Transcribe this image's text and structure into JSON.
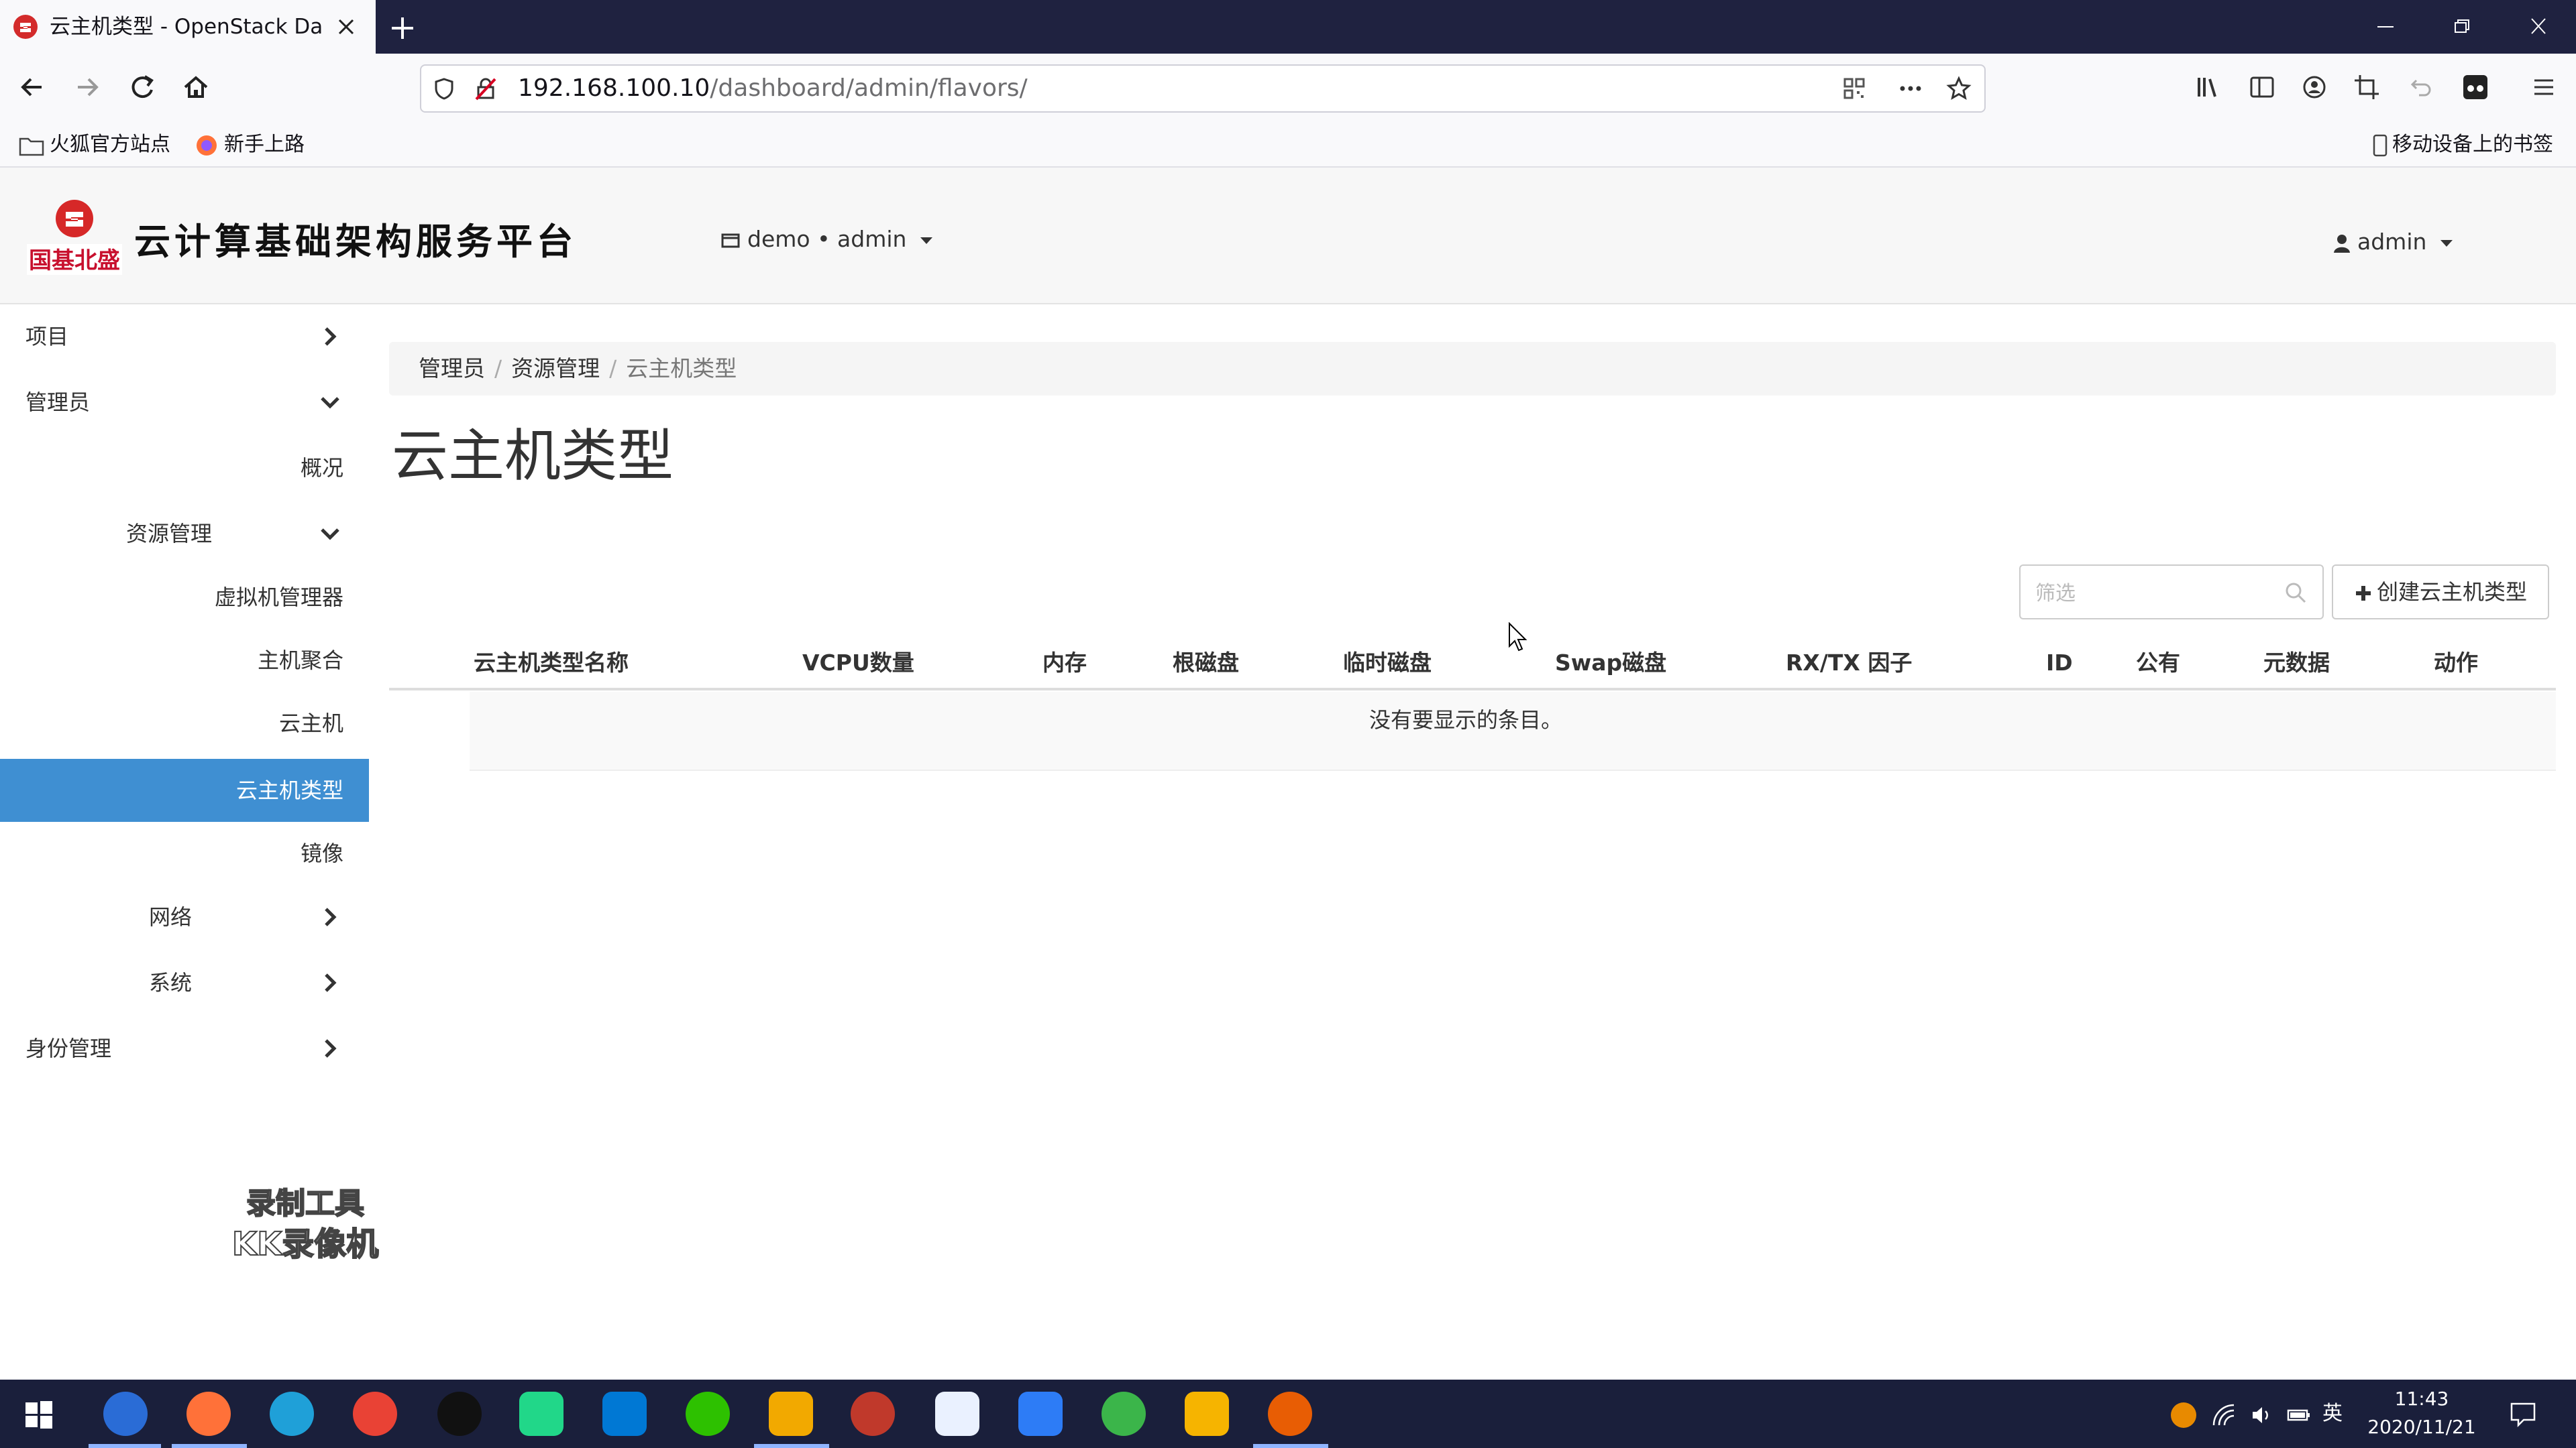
{
  "browser": {
    "tab_title": "云主机类型 - OpenStack Dashboard",
    "url_host": "192.168.100.10",
    "url_path": "/dashboard/admin/flavors/",
    "bookmarks": [
      "火狐官方站点",
      "新手上路"
    ],
    "mobile_bookmarks": "移动设备上的书签"
  },
  "header": {
    "logo_caption": "国基北盛",
    "logo_text": "云计算基础架构服务平台",
    "project_selector": "demo • admin",
    "user_menu": "admin"
  },
  "sidebar": {
    "items": [
      {
        "label": "项目"
      },
      {
        "label": "管理员"
      },
      {
        "label": "概况"
      },
      {
        "label": "资源管理"
      },
      {
        "label": "虚拟机管理器"
      },
      {
        "label": "主机聚合"
      },
      {
        "label": "云主机"
      },
      {
        "label": "云主机类型"
      },
      {
        "label": "镜像"
      },
      {
        "label": "网络"
      },
      {
        "label": "系统"
      },
      {
        "label": "身份管理"
      }
    ]
  },
  "breadcrumb": [
    "管理员",
    "资源管理",
    "云主机类型"
  ],
  "page_title": "云主机类型",
  "toolbar": {
    "filter_placeholder": "筛选",
    "create_label": "创建云主机类型"
  },
  "table": {
    "columns": [
      "云主机类型名称",
      "VCPU数量",
      "内存",
      "根磁盘",
      "临时磁盘",
      "Swap磁盘",
      "RX/TX 因子",
      "ID",
      "公有",
      "元数据",
      "动作"
    ],
    "empty_text": "没有要显示的条目。"
  },
  "watermark": [
    "录制工具",
    "KK录像机"
  ],
  "taskbar": {
    "ime": "英",
    "time": "11:43",
    "date": "2020/11/21"
  },
  "colors": {
    "accent": "#3f8fd2",
    "tabstrip": "#1f2240",
    "taskbar": "#1a1f3b"
  }
}
